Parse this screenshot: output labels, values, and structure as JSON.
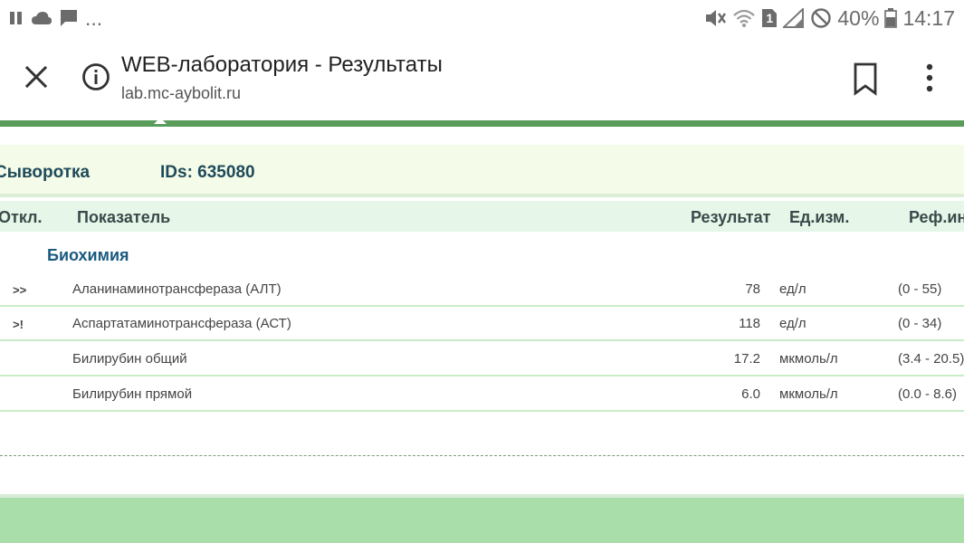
{
  "status_bar": {
    "left_dots": "...",
    "battery_percent": "40%",
    "time": "14:17",
    "sim_label": "1",
    "icons_left": [
      "pause-icon",
      "cloud-icon",
      "chat-bubble-icon"
    ],
    "icons_right": [
      "mute-icon",
      "wifi-icon",
      "sim-icon",
      "signal-icon",
      "block-icon",
      "battery-icon"
    ]
  },
  "toolbar": {
    "title": "WEB-лаборатория - Результаты",
    "url": "lab.mc-aybolit.ru",
    "icons": [
      "close-icon",
      "info-icon",
      "bookmark-icon",
      "more-vert-icon"
    ]
  },
  "sample": {
    "type": "Сыворотка",
    "ids": "IDs: 635080"
  },
  "table": {
    "headers": {
      "deviation": "Откл.",
      "parameter": "Показатель",
      "result": "Результат",
      "unit": "Ед.изм.",
      "reference": "Реф.ин"
    },
    "group": "Биохимия",
    "rows": [
      {
        "flag": ">>",
        "name": "Аланинаминотрансфераза (АЛТ)",
        "value": "78",
        "unit": "ед/л",
        "ref": "(0 - 55)"
      },
      {
        "flag": ">!",
        "name": "Аспартатаминотрансфераза (АСТ)",
        "value": "118",
        "unit": "ед/л",
        "ref": "(0 - 34)"
      },
      {
        "flag": "",
        "name": "Билирубин общий",
        "value": "17.2",
        "unit": "мкмоль/л",
        "ref": "(3.4 - 20.5)"
      },
      {
        "flag": "",
        "name": "Билирубин прямой",
        "value": "6.0",
        "unit": "мкмоль/л",
        "ref": "(0.0 - 8.6)"
      }
    ]
  },
  "colors": {
    "accent_green": "#5a9c5a",
    "footer_green": "#a9dda9",
    "header_text": "#1e4a5a",
    "group_text": "#1a5a80"
  }
}
